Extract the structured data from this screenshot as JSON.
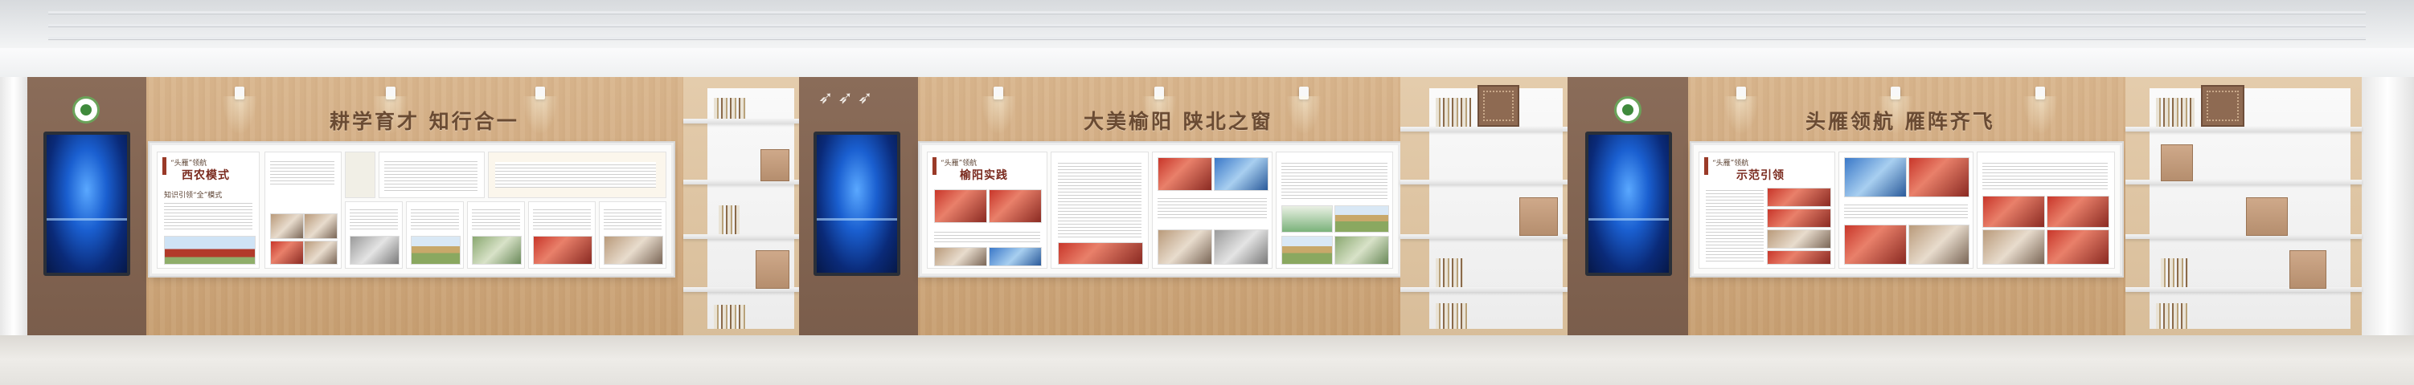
{
  "panels": [
    {
      "headline": "耕学育才 知行合一",
      "board": {
        "intro_tag": "“头雁”领航",
        "intro_title": "西农模式",
        "sub_heading": "知识引领“全”模式"
      }
    },
    {
      "headline": "大美榆阳 陕北之窗",
      "board": {
        "intro_tag": "“头雁”领航",
        "intro_title": "榆阳实践"
      }
    },
    {
      "headline": "头雁领航 雁阵齐飞",
      "board": {
        "intro_tag": "“头雁”领航",
        "intro_title": "示范引领"
      }
    }
  ],
  "colors": {
    "wood": "#d3ab80",
    "brown_panel": "#7f6250",
    "headline_text": "#6a4b33",
    "accent_red": "#9a3a28",
    "emblem_green": "#3f8a3c"
  },
  "icons": [
    "emblem-logo-icon",
    "flying-geese-icon",
    "spotlight-icon"
  ]
}
